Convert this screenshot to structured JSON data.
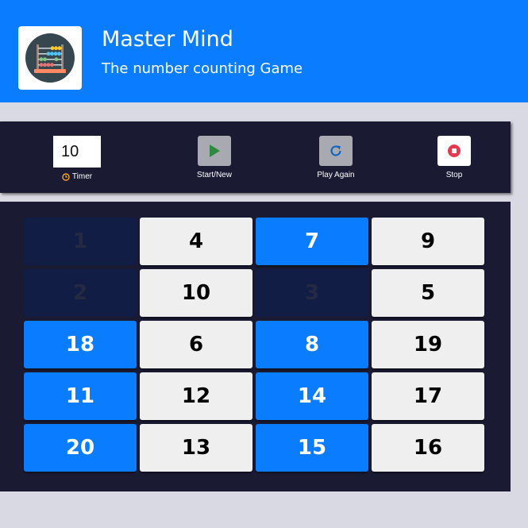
{
  "header": {
    "title": "Master Mind",
    "subtitle": "The number counting Game",
    "logo_icon": "abacus-icon",
    "background": "#0a7cff"
  },
  "toolbar": {
    "timer_value": "10",
    "timer_label": "Timer",
    "start_label": "Start/New",
    "play_again_label": "Play Again",
    "stop_label": "Stop",
    "icons": {
      "timer": "clock-icon",
      "start": "play-icon",
      "play_again": "refresh-icon",
      "stop": "stop-icon"
    }
  },
  "board": {
    "cells": [
      {
        "value": "1",
        "state": "done"
      },
      {
        "value": "4",
        "state": "white"
      },
      {
        "value": "7",
        "state": "blue"
      },
      {
        "value": "9",
        "state": "white"
      },
      {
        "value": "2",
        "state": "done"
      },
      {
        "value": "10",
        "state": "white"
      },
      {
        "value": "3",
        "state": "done"
      },
      {
        "value": "5",
        "state": "white"
      },
      {
        "value": "18",
        "state": "blue"
      },
      {
        "value": "6",
        "state": "white"
      },
      {
        "value": "8",
        "state": "blue"
      },
      {
        "value": "19",
        "state": "white"
      },
      {
        "value": "11",
        "state": "blue"
      },
      {
        "value": "12",
        "state": "white"
      },
      {
        "value": "14",
        "state": "blue"
      },
      {
        "value": "17",
        "state": "white"
      },
      {
        "value": "20",
        "state": "blue"
      },
      {
        "value": "13",
        "state": "white"
      },
      {
        "value": "15",
        "state": "blue"
      },
      {
        "value": "16",
        "state": "white"
      }
    ]
  },
  "colors": {
    "accent": "#0a7cff",
    "panel": "#1a1a33",
    "done_cell": "#111d44",
    "page_bg": "#d9d9e3"
  }
}
